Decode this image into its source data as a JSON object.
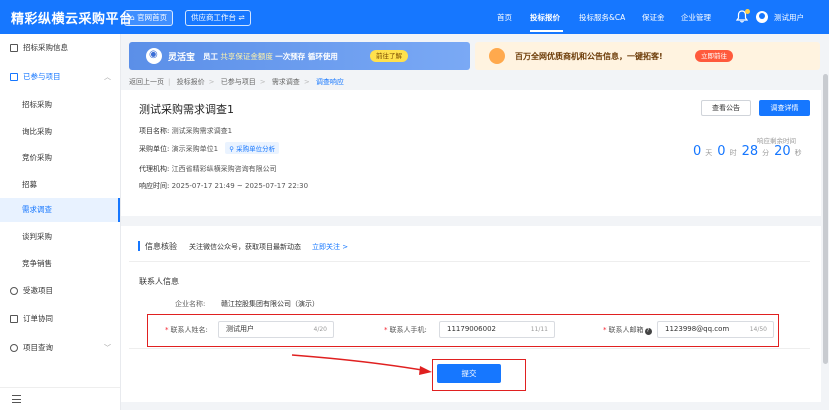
{
  "header": {
    "app_title": "精彩纵横云采购平台",
    "home_btn": "官网首页",
    "supplier_btn": "供应商工作台 ⇌",
    "nav": [
      "首页",
      "投标报价",
      "投标服务&CA",
      "保证金",
      "企业管理"
    ],
    "active_nav": "投标报价",
    "username": "测试用户",
    "notification_dot_color": "#ffd04b"
  },
  "sidebar": {
    "items": [
      {
        "label": "招标采购信息",
        "icon": "document-icon"
      },
      {
        "label": "已参与项目",
        "icon": "folder-icon",
        "expanded": true
      },
      {
        "label": "招标采购"
      },
      {
        "label": "询比采购"
      },
      {
        "label": "竞价采购"
      },
      {
        "label": "招募"
      },
      {
        "label": "需求调查",
        "active": true
      },
      {
        "label": "谈判采购"
      },
      {
        "label": "竞争销售"
      },
      {
        "label": "受邀项目",
        "icon": "invite-icon"
      },
      {
        "label": "订单协同",
        "icon": "order-icon"
      },
      {
        "label": "项目查询",
        "icon": "query-icon"
      }
    ],
    "footer_icon": "menu-collapse-icon"
  },
  "banners": {
    "left": {
      "title": "灵活宝",
      "text_prefix": "员工",
      "text_highlight": "共享保证金额度",
      "text_suffix": "一次预存 循环使用",
      "button": "前往了解"
    },
    "right": {
      "text": "百万全网优质商机和公告信息，一键拓客!",
      "button": "立即前往"
    }
  },
  "breadcrumb": {
    "items": [
      "返回上一页",
      "投标报价",
      "已参与项目",
      "需求调查",
      "调查响应"
    ]
  },
  "project": {
    "title": "测试采购需求调查1",
    "view_notice_btn": "查看公告",
    "detail_btn": "调查详情",
    "fields": [
      {
        "label": "项目名称:",
        "value": "测试采购需求调查1"
      },
      {
        "label": "采购单位:",
        "value": "演示采购单位1"
      },
      {
        "label": "代理机构:",
        "value": "江西省精彩纵横采购咨询有限公司"
      },
      {
        "label": "响应时间:",
        "value": "2025-07-17 21:49 ~ 2025-07-17 22:30"
      }
    ],
    "analysis_tag": "采购单位分析",
    "remaining_label": "响应剩余时间",
    "countdown": {
      "days": "0",
      "days_unit": "天",
      "hours": "0",
      "hours_unit": "时",
      "minutes": "28",
      "minutes_unit": "分",
      "seconds": "20",
      "seconds_unit": "秒"
    }
  },
  "verify": {
    "title": "信息核验",
    "text": "关注微信公众号，获取项目最新动态",
    "link": "立即关注 >"
  },
  "contact": {
    "section_title": "联系人信息",
    "company_label": "企业名称:",
    "company_value": "赣江控股集团有限公司（演示）",
    "name": {
      "label": "联系人姓名:",
      "value": "测试用户",
      "count": "4/20"
    },
    "phone": {
      "label": "联系人手机:",
      "value": "11179006002",
      "count": "11/11"
    },
    "email": {
      "label": "联系人邮箱",
      "value": "1123998@qq.com",
      "count": "14/50"
    },
    "submit": "提交"
  },
  "colors": {
    "primary": "#1677ff",
    "annotation_red": "#e02020"
  }
}
